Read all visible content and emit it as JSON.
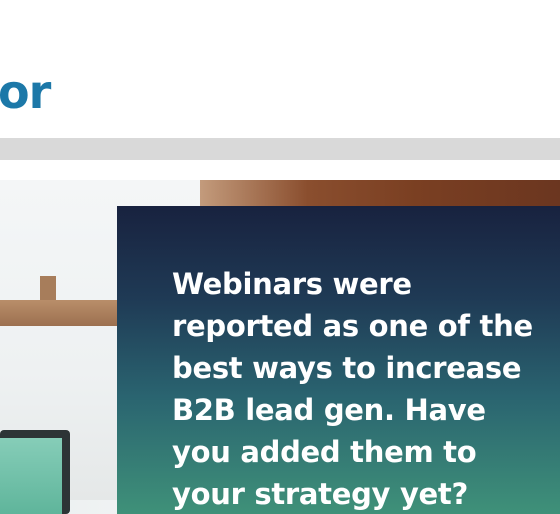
{
  "header": {
    "logo_text": "or"
  },
  "hero": {
    "headline": "Webinars were reported as one of the best ways to increase B2B lead gen. Have you added them to your strategy yet?"
  },
  "colors": {
    "logo": "#1c78a8",
    "divider": "#d9d9d9",
    "cta_top": "#18223f",
    "cta_bottom": "#3f9179"
  }
}
